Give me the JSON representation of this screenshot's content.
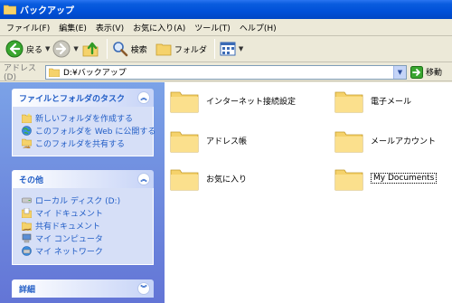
{
  "window": {
    "title": "バックアップ"
  },
  "menu": [
    "ファイル(F)",
    "編集(E)",
    "表示(V)",
    "お気に入り(A)",
    "ツール(T)",
    "ヘルプ(H)"
  ],
  "toolbar": {
    "back_label": "戻る",
    "search_label": "検索",
    "folders_label": "フォルダ"
  },
  "address": {
    "label": "アドレス(D)",
    "value": "D:¥バックアップ",
    "go_label": "移動"
  },
  "tasks": {
    "title": "ファイルとフォルダのタスク",
    "items": [
      "新しいフォルダを作成する",
      "このフォルダを Web に公開する",
      "このフォルダを共有する"
    ]
  },
  "other_places": {
    "title": "その他",
    "items": [
      "ローカル ディスク (D:)",
      "マイ ドキュメント",
      "共有ドキュメント",
      "マイ コンピュータ",
      "マイ ネットワーク"
    ]
  },
  "details": {
    "title": "詳細"
  },
  "folders": [
    "インターネット接続設定",
    "電子メール",
    "アドレス帳",
    "メールアカウント",
    "お気に入り",
    "My Documents"
  ],
  "colors": {
    "title_bar": "#0054e3",
    "task_pane": "#6f8fdc",
    "link": "#215dc6",
    "folder": "#f5d26b"
  }
}
